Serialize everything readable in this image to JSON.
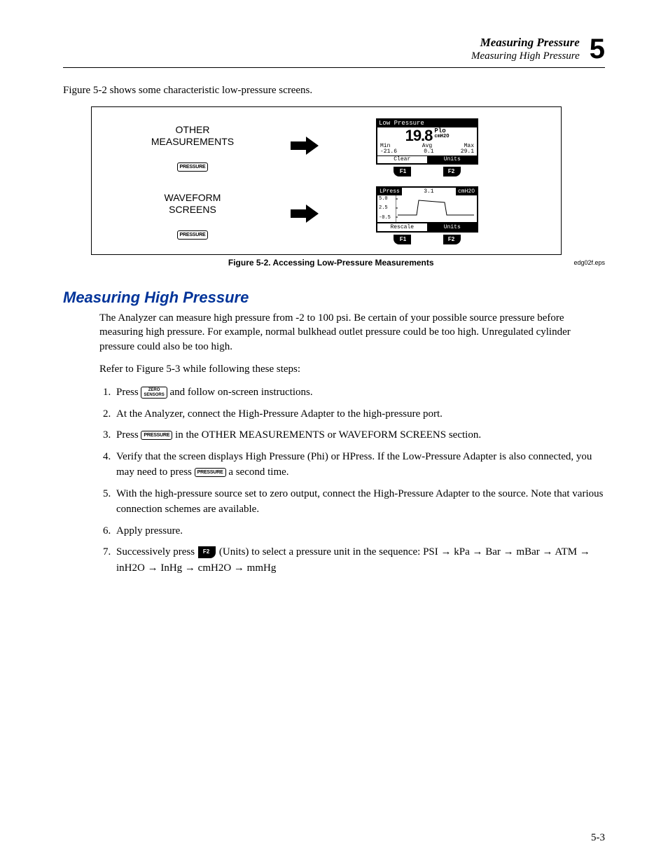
{
  "header": {
    "line1": "Measuring Pressure",
    "line2": "Measuring High Pressure",
    "chapter": "5"
  },
  "intro": "Figure 5-2 shows some characteristic low-pressure screens.",
  "figure": {
    "row1_label1": "OTHER",
    "row1_label2": "MEASUREMENTS",
    "row2_label1": "WAVEFORM",
    "row2_label2": "SCREENS",
    "pressure_key": "PRESSURE",
    "lcd1": {
      "title": "Low Pressure",
      "value": "19.8",
      "unit_line1": "Plo",
      "unit_line2": "cmH2O",
      "min_h": "Min",
      "avg_h": "Avg",
      "max_h": "Max",
      "min_v": "-21.6",
      "avg_v": "0.1",
      "max_v": "29.1",
      "left_bt": "Clear",
      "right_bt": "Units",
      "f1": "F1",
      "f2": "F2"
    },
    "lcd2": {
      "title": "LPress",
      "val": "3.1",
      "unit": "cmH2O",
      "y1": "5.0",
      "y2": "2.5",
      "y3": "-0.5",
      "left_bt": "Rescale",
      "right_bt": "Units",
      "f1": "F1",
      "f2": "F2"
    },
    "caption": "Figure 5-2. Accessing Low-Pressure Measurements",
    "eps": "edg02f.eps"
  },
  "section_heading": "Measuring High Pressure",
  "para1": "The Analyzer can measure high pressure from -2 to 100 psi. Be certain of your possible source pressure before measuring high pressure. For example, normal bulkhead outlet pressure could be too high. Unregulated cylinder pressure could also be too high.",
  "para2": "Refer to Figure 5-3 while following these steps:",
  "steps": {
    "s1a": "Press ",
    "s1_key_line1": "ZERO",
    "s1_key_line2": "SENSORS",
    "s1b": " and follow on-screen instructions.",
    "s2": "At the Analyzer, connect the High-Pressure Adapter to the high-pressure port.",
    "s3a": "Press ",
    "s3_key": "PRESSURE",
    "s3b": " in the OTHER MEASUREMENTS or WAVEFORM SCREENS section.",
    "s4a": "Verify that the screen displays High Pressure (Phi) or HPress. If the Low-Pressure Adapter is also connected, you may need to press ",
    "s4_key": "PRESSURE",
    "s4b": " a second time.",
    "s5": "With the high-pressure source set to zero output, connect the High-Pressure Adapter to the source. Note that various connection schemes are available.",
    "s6": "Apply pressure.",
    "s7a": "Successively press ",
    "s7_key": "F2",
    "s7b": " (Units) to select a pressure unit in the sequence: PSI ",
    "s7_arrow": "→",
    "s7_u1": " kPa ",
    "s7_u2": " Bar ",
    "s7_u3": " mBar ",
    "s7_u4": " ATM ",
    "s7_u5": " inH2O ",
    "s7_u6": " InHg ",
    "s7_u7": " cmH2O ",
    "s7_u8": " mmHg"
  },
  "page_number": "5-3"
}
